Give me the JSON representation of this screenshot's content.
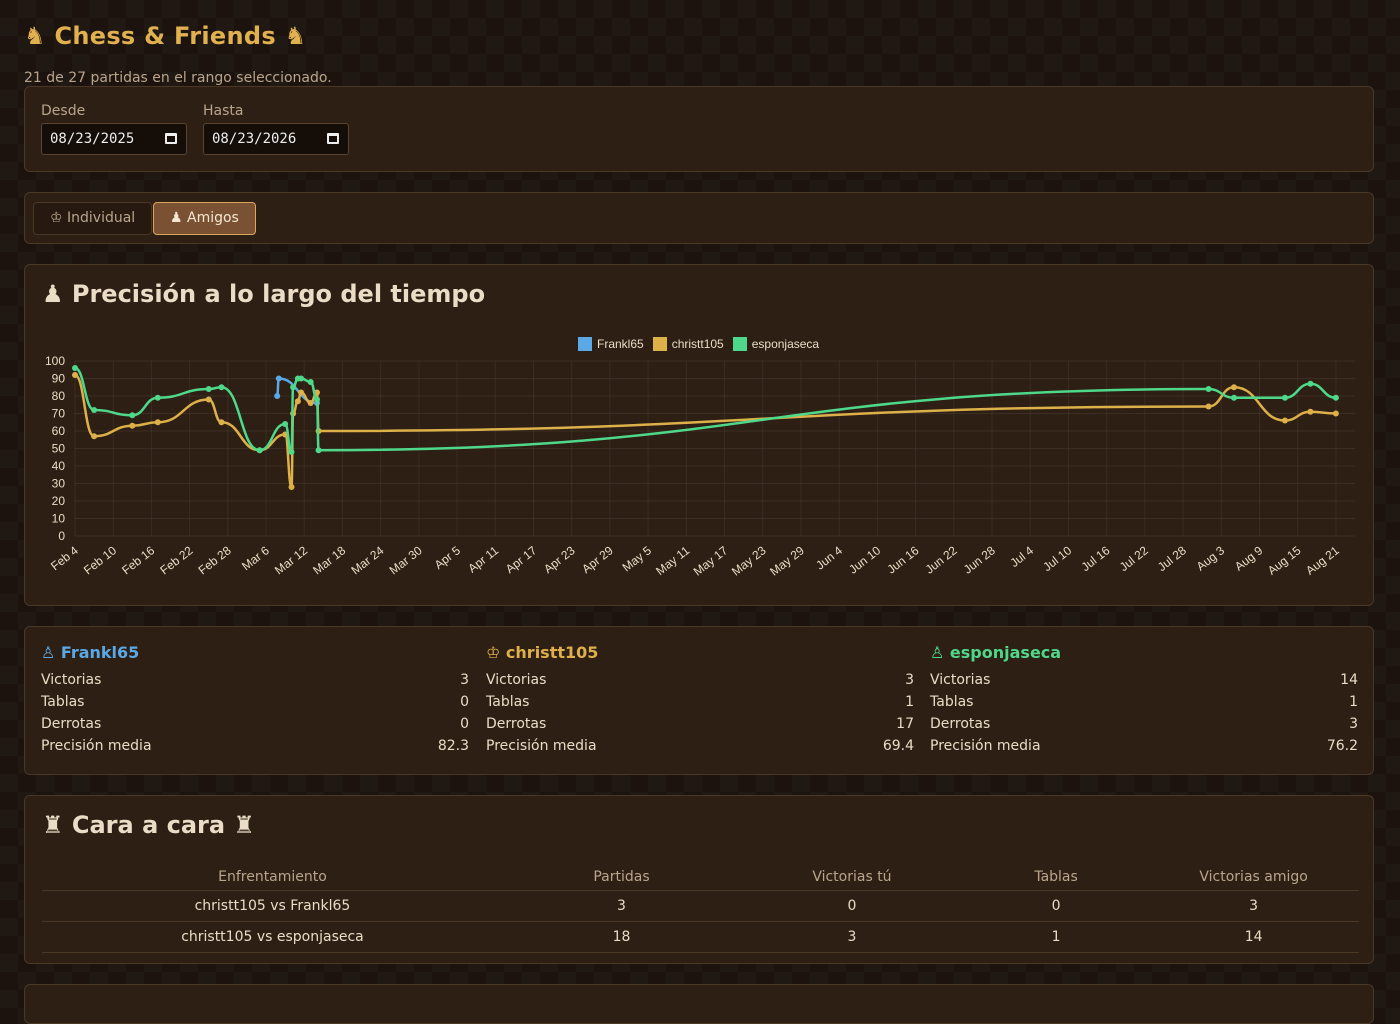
{
  "app": {
    "title": "♞ Chess & Friends ♞",
    "subtitle": "21 de 27 partidas en el rango seleccionado."
  },
  "filters": {
    "from_label": "Desde",
    "from_value": "08/23/2025",
    "to_label": "Hasta",
    "to_value": "08/23/2026"
  },
  "tabs": [
    {
      "label": "♔ Individual",
      "active": false
    },
    {
      "label": "♟ Amigos",
      "active": true
    }
  ],
  "accuracy_section": {
    "title": "♟ Precisión a lo largo del tiempo"
  },
  "colors": {
    "Frankl65": "#5aa9e6",
    "christt105": "#deb049",
    "esponjaseca": "#4ed88a",
    "title": "#e1b04f",
    "card_bg": "#2e1f14"
  },
  "chart_data": {
    "type": "line",
    "title": "",
    "xlabel": "",
    "ylabel": "",
    "ylim": [
      0,
      100
    ],
    "y_ticks": [
      "0",
      "10",
      "20",
      "30",
      "40",
      "50",
      "60",
      "70",
      "80",
      "90",
      "100"
    ],
    "x_tick_labels": [
      "Feb 4",
      "Feb 10",
      "Feb 16",
      "Feb 22",
      "Feb 28",
      "Mar 6",
      "Mar 12",
      "Mar 18",
      "Mar 24",
      "Mar 30",
      "Apr 5",
      "Apr 11",
      "Apr 17",
      "Apr 23",
      "Apr 29",
      "May 5",
      "May 11",
      "May 17",
      "May 23",
      "May 29",
      "Jun 4",
      "Jun 10",
      "Jun 16",
      "Jun 22",
      "Jun 28",
      "Jul 4",
      "Jul 10",
      "Jul 16",
      "Jul 22",
      "Jul 28",
      "Aug 3",
      "Aug 9",
      "Aug 15",
      "Aug 21"
    ],
    "x_range": [
      "2026-02-04",
      "2026-08-24"
    ],
    "grid": true,
    "legend_position": "top-center",
    "series": [
      {
        "name": "Frankl65",
        "color": "#5aa9e6",
        "points": [
          {
            "x": "2026-03-07T18:00",
            "y": 80
          },
          {
            "x": "2026-03-08",
            "y": 90
          },
          {
            "x": "2026-03-14",
            "y": 76
          }
        ]
      },
      {
        "name": "christt105",
        "color": "#deb049",
        "points": [
          {
            "x": "2026-02-04",
            "y": 92
          },
          {
            "x": "2026-02-07",
            "y": 57
          },
          {
            "x": "2026-02-13",
            "y": 63
          },
          {
            "x": "2026-02-17",
            "y": 65
          },
          {
            "x": "2026-02-25",
            "y": 78
          },
          {
            "x": "2026-02-27",
            "y": 65
          },
          {
            "x": "2026-03-05",
            "y": 49
          },
          {
            "x": "2026-03-09",
            "y": 58
          },
          {
            "x": "2026-03-10",
            "y": 28
          },
          {
            "x": "2026-03-10T06:00",
            "y": 70
          },
          {
            "x": "2026-03-11",
            "y": 77
          },
          {
            "x": "2026-03-11T12:00",
            "y": 82
          },
          {
            "x": "2026-03-13",
            "y": 76
          },
          {
            "x": "2026-03-14",
            "y": 82
          },
          {
            "x": "2026-03-14T06:00",
            "y": 60
          },
          {
            "x": "2026-08-01",
            "y": 74
          },
          {
            "x": "2026-08-05",
            "y": 85
          },
          {
            "x": "2026-08-13",
            "y": 66
          },
          {
            "x": "2026-08-17",
            "y": 71
          },
          {
            "x": "2026-08-21",
            "y": 70
          }
        ]
      },
      {
        "name": "esponjaseca",
        "color": "#4ed88a",
        "points": [
          {
            "x": "2026-02-04",
            "y": 96
          },
          {
            "x": "2026-02-07",
            "y": 72
          },
          {
            "x": "2026-02-13",
            "y": 69
          },
          {
            "x": "2026-02-17",
            "y": 79
          },
          {
            "x": "2026-02-25",
            "y": 84
          },
          {
            "x": "2026-02-27",
            "y": 85
          },
          {
            "x": "2026-03-05",
            "y": 49
          },
          {
            "x": "2026-03-09",
            "y": 64
          },
          {
            "x": "2026-03-10",
            "y": 48
          },
          {
            "x": "2026-03-10T06:00",
            "y": 85
          },
          {
            "x": "2026-03-11",
            "y": 90
          },
          {
            "x": "2026-03-11T12:00",
            "y": 90
          },
          {
            "x": "2026-03-13",
            "y": 88
          },
          {
            "x": "2026-03-14",
            "y": 78
          },
          {
            "x": "2026-03-14T06:00",
            "y": 49
          },
          {
            "x": "2026-08-01",
            "y": 84
          },
          {
            "x": "2026-08-05",
            "y": 79
          },
          {
            "x": "2026-08-13",
            "y": 79
          },
          {
            "x": "2026-08-17",
            "y": 87
          },
          {
            "x": "2026-08-21",
            "y": 79
          }
        ]
      }
    ]
  },
  "players": [
    {
      "icon": "♙",
      "name": "Frankl65",
      "color": "#5aa9e6",
      "stats": [
        {
          "label": "Victorias",
          "value": "3"
        },
        {
          "label": "Tablas",
          "value": "0"
        },
        {
          "label": "Derrotas",
          "value": "0"
        },
        {
          "label": "Precisión media",
          "value": "82.3"
        }
      ]
    },
    {
      "icon": "♔",
      "name": "christt105",
      "color": "#deb049",
      "stats": [
        {
          "label": "Victorias",
          "value": "3"
        },
        {
          "label": "Tablas",
          "value": "1"
        },
        {
          "label": "Derrotas",
          "value": "17"
        },
        {
          "label": "Precisión media",
          "value": "69.4"
        }
      ]
    },
    {
      "icon": "♙",
      "name": "esponjaseca",
      "color": "#4ed88a",
      "stats": [
        {
          "label": "Victorias",
          "value": "14"
        },
        {
          "label": "Tablas",
          "value": "1"
        },
        {
          "label": "Derrotas",
          "value": "3"
        },
        {
          "label": "Precisión media",
          "value": "76.2"
        }
      ]
    }
  ],
  "head_to_head": {
    "title": "♜ Cara a cara ♜",
    "columns": [
      "Enfrentamiento",
      "Partidas",
      "Victorias tú",
      "Tablas",
      "Victorias amigo"
    ],
    "rows": [
      [
        "christt105 vs Frankl65",
        "3",
        "0",
        "0",
        "3"
      ],
      [
        "christt105 vs esponjaseca",
        "18",
        "3",
        "1",
        "14"
      ]
    ]
  }
}
